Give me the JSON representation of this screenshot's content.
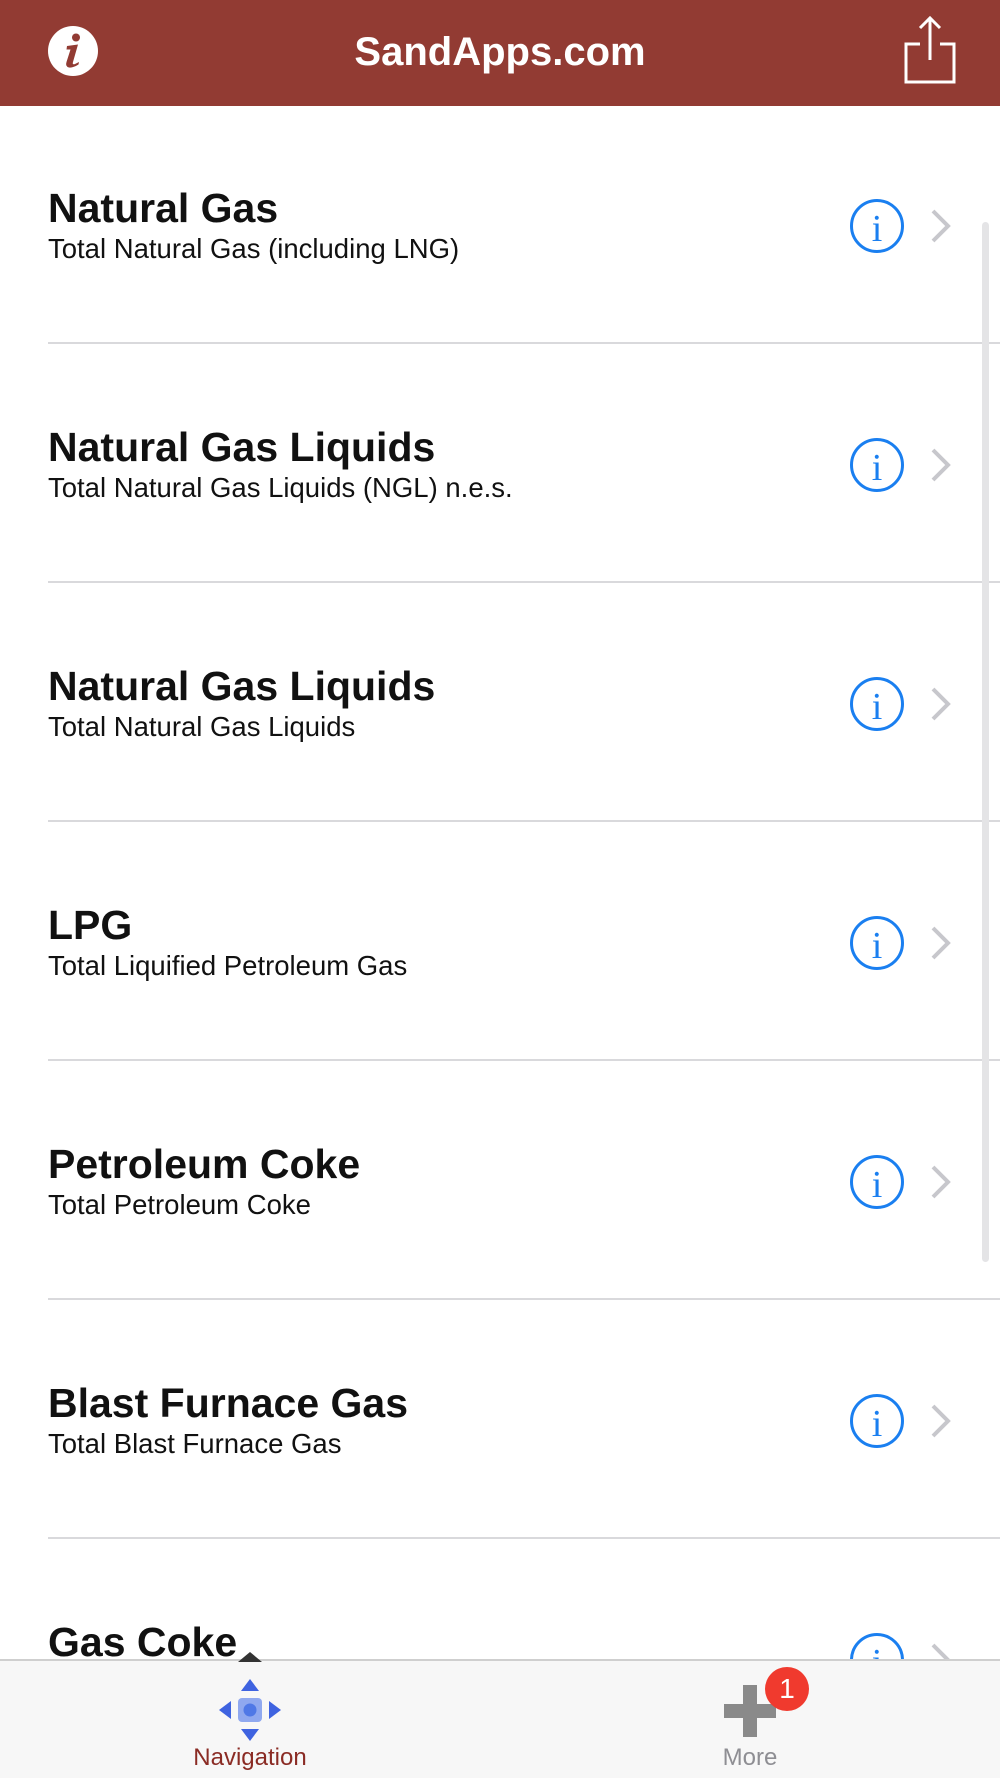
{
  "navbar": {
    "title": "SandApps.com",
    "info_icon": "info-icon",
    "share_icon": "share-icon",
    "background_color": "#923b33"
  },
  "list": {
    "items": [
      {
        "title": "Natural Gas",
        "subtitle": "Total Natural Gas (including LNG)"
      },
      {
        "title": "Natural Gas Liquids",
        "subtitle": "Total Natural Gas Liquids (NGL) n.e.s."
      },
      {
        "title": "Natural Gas Liquids",
        "subtitle": "Total Natural Gas Liquids"
      },
      {
        "title": "LPG",
        "subtitle": "Total Liquified Petroleum Gas"
      },
      {
        "title": "Petroleum Coke",
        "subtitle": "Total Petroleum Coke"
      },
      {
        "title": "Blast Furnace Gas",
        "subtitle": "Total Blast Furnace Gas"
      },
      {
        "title": "Gas Coke",
        "subtitle": ""
      }
    ],
    "detail_icon": "info-circle-icon",
    "accessory_icon": "chevron-right-icon",
    "accent_color": "#1a7ff0"
  },
  "tabbar": {
    "tabs": [
      {
        "label": "Navigation",
        "icon": "navigation-arrows-icon",
        "selected": true,
        "color": "#8a2b24"
      },
      {
        "label": "More",
        "icon": "plus-icon",
        "selected": false,
        "badge": "1",
        "color": "#8e8e93"
      }
    ]
  }
}
